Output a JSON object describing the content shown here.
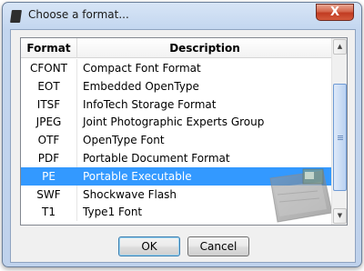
{
  "window": {
    "title": "Choose a format...",
    "close_glyph": "X"
  },
  "list": {
    "columns": {
      "format": "Format",
      "description": "Description"
    },
    "selected_index": 6,
    "rows": [
      {
        "format": "CFONT",
        "description": "Compact Font Format"
      },
      {
        "format": "EOT",
        "description": "Embedded OpenType"
      },
      {
        "format": "ITSF",
        "description": "InfoTech Storage Format"
      },
      {
        "format": "JPEG",
        "description": "Joint Photographic Experts Group"
      },
      {
        "format": "OTF",
        "description": "OpenType Font"
      },
      {
        "format": "PDF",
        "description": "Portable Document Format"
      },
      {
        "format": "PE",
        "description": "Portable Executable"
      },
      {
        "format": "SWF",
        "description": "Shockwave Flash"
      },
      {
        "format": "T1",
        "description": "Type1 Font"
      }
    ]
  },
  "buttons": {
    "ok": "OK",
    "cancel": "Cancel"
  },
  "icons": {
    "app": "format-app-icon",
    "close": "close-icon",
    "scroll_up": "scroll-up-arrow-icon",
    "scroll_down": "scroll-down-arrow-icon",
    "drag": "document-drag-icon"
  },
  "colors": {
    "selection": "#3399ff",
    "close_button": "#c94a2f",
    "title_bar": "#c3d6ef"
  }
}
